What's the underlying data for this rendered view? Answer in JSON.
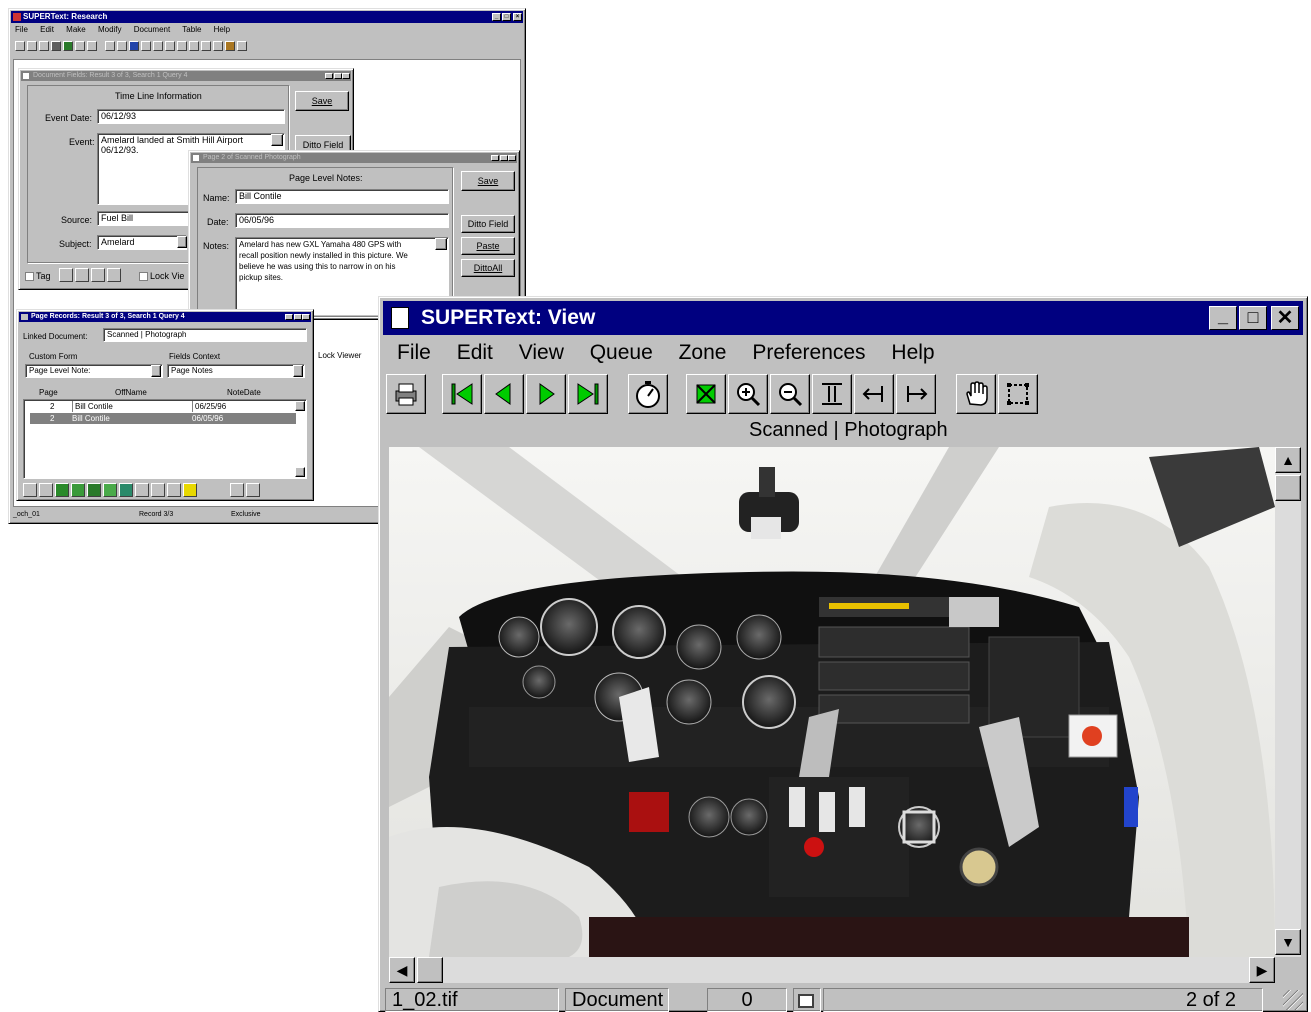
{
  "research": {
    "title": "SUPERText: Research",
    "menu": [
      "File",
      "Edit",
      "Make",
      "Modify",
      "Document",
      "Table",
      "Help"
    ],
    "status": {
      "left": "_och_01",
      "record": "Record 3/3",
      "mode": "Exclusive"
    }
  },
  "docfields": {
    "title": "Document Fields: Result 3 of 3, Search 1 Query 4",
    "group_title": "Time Line Information",
    "event_date_label": "Event Date:",
    "event_date": "06/12/93",
    "event_label": "Event:",
    "event_line1": "Amelard landed at Smith Hill Airport",
    "event_line2": "06/12/93.",
    "source_label": "Source:",
    "source": "Fuel Bill",
    "subject_label": "Subject:",
    "subject": "Amelard",
    "save": "Save",
    "ditto_field": "Ditto Field",
    "tag": "Tag",
    "lock_viewer": "Lock Vie"
  },
  "pagenotes": {
    "title": "Page 2 of Scanned Photograph",
    "group_title": "Page Level Notes:",
    "name_label": "Name:",
    "name": "Bill Contile",
    "date_label": "Date:",
    "date": "06/05/96",
    "notes_label": "Notes:",
    "notes_lines": [
      "Amelard has new GXL Yamaha 480 GPS with",
      "recall position newly installed in this picture. We",
      "believe he was using this to narrow in on his",
      "pickup sites."
    ],
    "save": "Save",
    "ditto_field": "Ditto Field",
    "paste": "Paste",
    "ditto_all": "DittoAll"
  },
  "pagerecords": {
    "title": "Page Records: Result 3 of 3, Search 1 Query 4",
    "linked_label": "Linked Document:",
    "linked_value": "Scanned | Photograph",
    "custom_form_label": "Custom Form",
    "fields_context_label": "Fields Context",
    "custom_form_value": "Page Level Note:",
    "fields_context_value": "Page Notes",
    "columns": [
      "Page",
      "OffName",
      "NoteDate"
    ],
    "rows": [
      {
        "page": "2",
        "name": "Bill Contile",
        "date": "06/25/96"
      },
      {
        "page": "2",
        "name": "Bill Contile",
        "date": "06/05/96"
      }
    ],
    "lock_viewer": "Lock Viewer"
  },
  "viewer": {
    "title": "SUPERText: View",
    "menu": [
      "File",
      "Edit",
      "View",
      "Queue",
      "Zone",
      "Preferences",
      "Help"
    ],
    "doc_name": "Scanned | Photograph",
    "toolbar": [
      "print-icon",
      "first-page-icon",
      "prev-page-icon",
      "next-page-icon",
      "last-page-icon",
      "stopwatch-icon",
      "fit-page-icon",
      "zoom-in-icon",
      "zoom-out-icon",
      "fit-height-icon",
      "fit-width-left-icon",
      "fit-width-right-icon",
      "hand-pan-icon",
      "select-region-icon"
    ],
    "status": {
      "file": "1_02.tif",
      "type": "Document",
      "count": "0",
      "pages": "2 of 2"
    }
  }
}
